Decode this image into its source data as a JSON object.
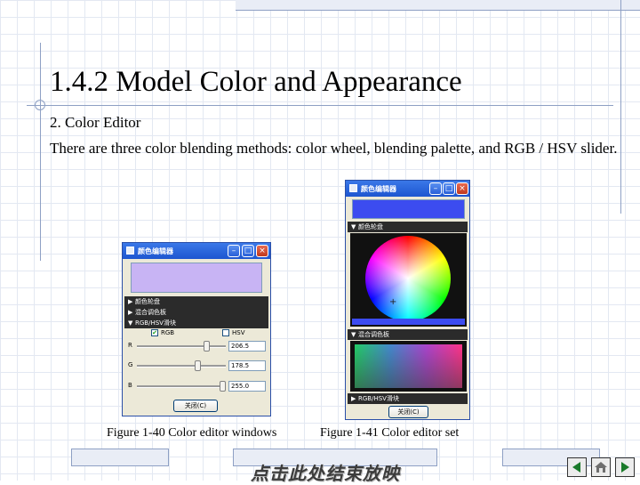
{
  "slide": {
    "title": "1.4.2  Model Color and Appearance",
    "subtitle": "2. Color Editor",
    "body": "There are three color blending methods: color wheel, blending palette, and RGB / HSV slider.",
    "footer_link": "点击此处结束放映"
  },
  "figures": [
    {
      "caption": "Figure 1-40 Color editor windows"
    },
    {
      "caption": "Figure 1-41 Color editor set"
    }
  ],
  "win1": {
    "title": "颜色编辑器",
    "preview_color": "#c8b4f4",
    "sections": [
      "颜色轮盘",
      "混合调色板",
      "RGB/HSV滑块"
    ],
    "mode_rgb": "RGB",
    "mode_hsv": "HSV",
    "sliders": [
      {
        "label": "R",
        "value_text": "206.5",
        "value": 206.5
      },
      {
        "label": "G",
        "value_text": "178.5",
        "value": 178.5
      },
      {
        "label": "B",
        "value_text": "255.0",
        "value": 255.0
      }
    ],
    "close_button": "关闭(C)"
  },
  "win2": {
    "title": "颜色编辑器",
    "preview_color": "#3c4cf0",
    "sections": [
      "颜色轮盘",
      "混合调色板",
      "RGB/HSV滑块"
    ],
    "close_button": "关闭(C)"
  },
  "colors": {
    "accent": "#1d55d0",
    "title_bar": "#2a4fa8",
    "section_bar": "#2b2b2b"
  },
  "icons": [
    "window-icon",
    "minimize-icon",
    "maximize-icon",
    "close-icon",
    "previous-slide-icon",
    "home-icon",
    "next-slide-icon"
  ]
}
